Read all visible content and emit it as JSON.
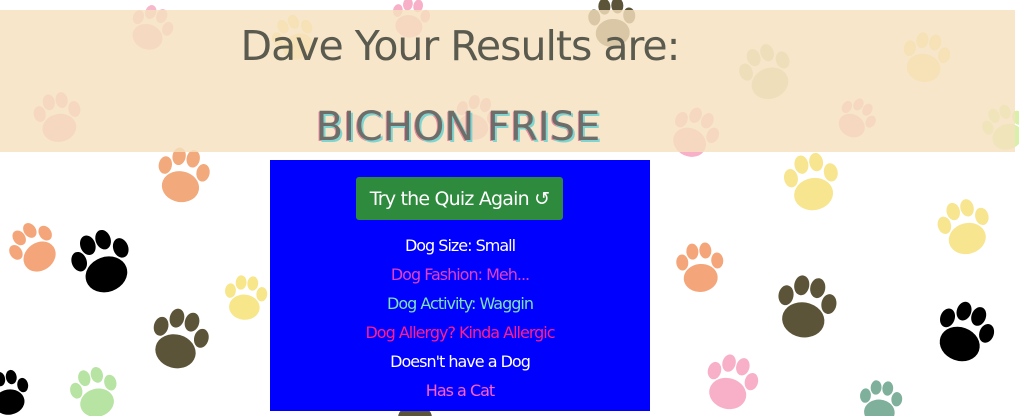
{
  "result": {
    "heading": "Dave Your Results are:",
    "breed": "BICHON FRISE"
  },
  "actions": {
    "retry_label": "Try the Quiz Again ↺"
  },
  "answers": [
    {
      "text": "Dog Size: Small",
      "color": "#ffffff"
    },
    {
      "text": "Dog Fashion: Meh...",
      "color": "#e040c8"
    },
    {
      "text": "Dog Activity: Waggin",
      "color": "#7fe0c8"
    },
    {
      "text": "Dog Allergy? Kinda Allergic",
      "color": "#ff1f8a"
    },
    {
      "text": "Doesn't have a Dog",
      "color": "#ffffff"
    },
    {
      "text": "Has a Cat",
      "color": "#ff5fd0"
    }
  ],
  "colors": {
    "panel_background": "#0000ff",
    "retry_button": "#2e8a3c",
    "header_band": "#f5e1be"
  },
  "background": {
    "icon": "paw-print-icon"
  }
}
